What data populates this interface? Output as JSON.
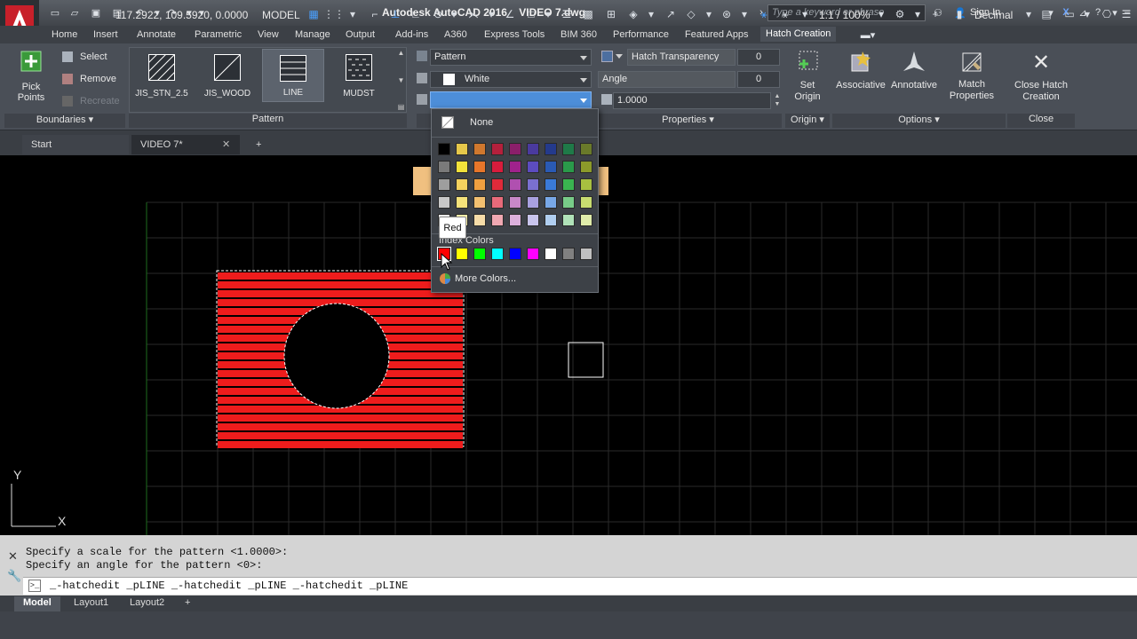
{
  "window": {
    "title": "Autodesk AutoCAD 2016",
    "filename": "VIDEO 7.dwg",
    "search_placeholder": "Type a keyword or phrase",
    "signin": "Sign In"
  },
  "ribbon_tabs": [
    "Home",
    "Insert",
    "Annotate",
    "Parametric",
    "View",
    "Manage",
    "Output",
    "Add-ins",
    "A360",
    "Express Tools",
    "BIM 360",
    "Performance",
    "Featured Apps",
    "Hatch Creation"
  ],
  "active_tab": "Hatch Creation",
  "boundaries": {
    "pick_points": "Pick Points",
    "select": "Select",
    "remove": "Remove",
    "recreate": "Recreate",
    "title": "Boundaries"
  },
  "pattern": {
    "items": [
      "JIS_STN_2.5",
      "JIS_WOOD",
      "LINE",
      "MUDST"
    ],
    "selected": "LINE",
    "title": "Pattern"
  },
  "properties": {
    "pattern_type": "Pattern",
    "color": "White",
    "background_color": "",
    "transparency_label": "Hatch Transparency",
    "transparency_value": "0",
    "angle_label": "Angle",
    "angle_value": "0",
    "scale_value": "1.0000",
    "title": "Properties"
  },
  "origin": {
    "set_origin": "Set Origin",
    "title": "Origin"
  },
  "options": {
    "associative": "Associative",
    "annotative": "Annotative",
    "match_properties": "Match Properties",
    "title": "Options"
  },
  "close_panel": {
    "close_hatch": "Close Hatch Creation",
    "title": "Close"
  },
  "doc_tabs": [
    "Start",
    "VIDEO 7*"
  ],
  "color_dropdown": {
    "none_label": "None",
    "grid_colors": [
      [
        "#000000",
        "#e6c84a",
        "#d0782e",
        "#b4203c",
        "#8a1f6a",
        "#4a3a9e",
        "#243a8c",
        "#1f7a48",
        "#6a7a2a"
      ],
      [
        "#7a7a7a",
        "#f2e23a",
        "#e8762a",
        "#d81c3c",
        "#a0228c",
        "#5c4cc0",
        "#2a5ab4",
        "#2a9a4a",
        "#8c9a2a"
      ],
      [
        "#9e9e9e",
        "#f5d25e",
        "#f0a040",
        "#e02a3a",
        "#b050b0",
        "#7a70d0",
        "#3a7ad8",
        "#3ab450",
        "#a8c040"
      ],
      [
        "#c8c8c8",
        "#f5e27a",
        "#f3c070",
        "#e86a7a",
        "#c888c8",
        "#a8a0e0",
        "#78a8e8",
        "#78cc88",
        "#c8dc70"
      ],
      [
        "#ececec",
        "#f8eeaa",
        "#f6dca8",
        "#f0a8b2",
        "#dcb0dc",
        "#c8c4ec",
        "#b0cef0",
        "#b0e2b8",
        "#e0ecaa"
      ]
    ],
    "index_colors_label": "Index Colors",
    "index_colors": [
      "#ff0000",
      "#ffff00",
      "#00ff00",
      "#00ffff",
      "#0000ff",
      "#ff00ff",
      "#ffffff",
      "#808080",
      "#c0c0c0"
    ],
    "more_colors": "More Colors...",
    "tooltip": "Red"
  },
  "canvas": {
    "ucs_y": "Y",
    "ucs_x": "X",
    "hatch_color": "#ee1c1c",
    "grid_color": "#2a2a2a"
  },
  "command": {
    "history": [
      "Specify a scale for the pattern <1.0000>:",
      "Specify an angle for the pattern <0>:"
    ],
    "current": "_-hatchedit _pLINE _-hatchedit _pLINE _-hatchedit _pLINE"
  },
  "layout_tabs": [
    "Model",
    "Layout1",
    "Layout2"
  ],
  "status": {
    "coords": "117.2922, 109.5920, 0.0000",
    "space": "MODEL",
    "scale": "1:1 / 100%",
    "units": "Decimal"
  }
}
